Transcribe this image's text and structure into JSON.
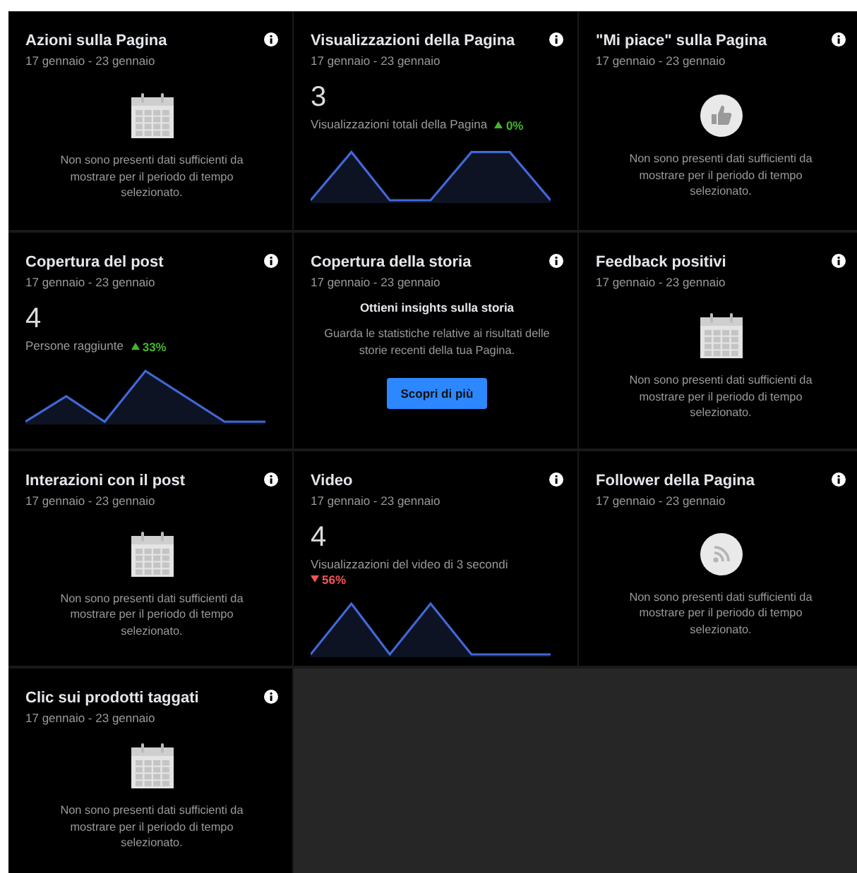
{
  "cards": [
    {
      "kind": "empty_calendar",
      "title": "Azioni sulla Pagina",
      "date": "17 gennaio - 23 gennaio",
      "message": "Non sono presenti dati sufficienti da mostrare per il periodo di tempo selezionato."
    },
    {
      "kind": "metric",
      "title": "Visualizzazioni della Pagina",
      "date": "17 gennaio - 23 gennaio",
      "value": "3",
      "label": "Visualizzazioni totali della Pagina",
      "change": {
        "kind": "increase",
        "text": "0%"
      }
    },
    {
      "kind": "empty_like",
      "title": "\"Mi piace\" sulla Pagina",
      "date": "17 gennaio - 23 gennaio",
      "message": "Non sono presenti dati sufficienti da mostrare per il periodo di tempo selezionato."
    },
    {
      "kind": "metric",
      "title": "Copertura del post",
      "date": "17 gennaio - 23 gennaio",
      "value": "4",
      "label": "Persone raggiunte",
      "change": {
        "kind": "increase",
        "text": "33%"
      }
    },
    {
      "kind": "promo",
      "title": "Copertura della storia",
      "date": "17 gennaio - 23 gennaio",
      "heading": "Ottieni insights sulla storia",
      "text": "Guarda le statistiche relative ai risultati delle storie recenti della tua Pagina.",
      "button": "Scopri di più"
    },
    {
      "kind": "empty_calendar",
      "title": "Feedback positivi",
      "date": "17 gennaio - 23 gennaio",
      "message": "Non sono presenti dati sufficienti da mostrare per il periodo di tempo selezionato."
    },
    {
      "kind": "empty_calendar",
      "title": "Interazioni con il post",
      "date": "17 gennaio - 23 gennaio",
      "message": "Non sono presenti dati sufficienti da mostrare per il periodo di tempo selezionato."
    },
    {
      "kind": "metric",
      "title": "Video",
      "date": "17 gennaio - 23 gennaio",
      "value": "4",
      "label": "Visualizzazioni del video di 3 secondi",
      "change": {
        "kind": "decrease",
        "text": "56%"
      }
    },
    {
      "kind": "empty_feed",
      "title": "Follower della Pagina",
      "date": "17 gennaio - 23 gennaio",
      "message": "Non sono presenti dati sufficienti da mostrare per il periodo di tempo selezionato."
    },
    {
      "kind": "empty_calendar",
      "title": "Clic sui prodotti taggati",
      "date": "17 gennaio - 23 gennaio",
      "message": "Non sono presenti dati sufficienti da mostrare per il periodo di tempo selezionato."
    }
  ]
}
